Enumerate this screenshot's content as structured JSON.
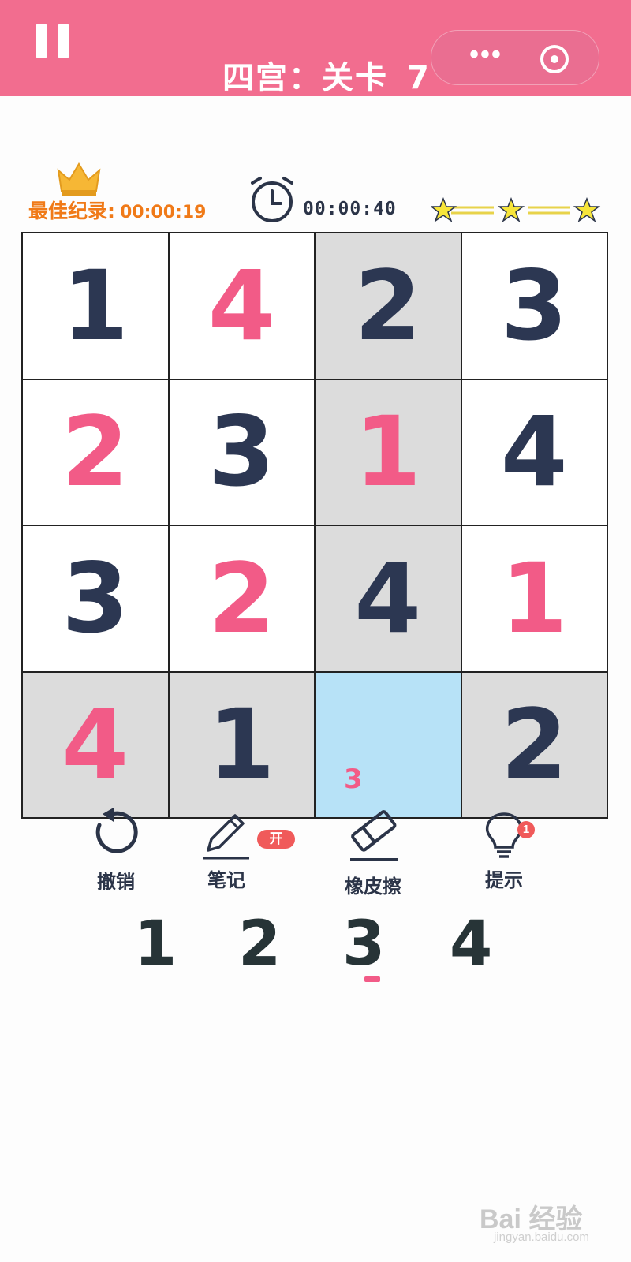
{
  "header": {
    "title": "四宫：关卡",
    "level": "7",
    "menu_dots": "•••",
    "pause_icon": "pause-icon",
    "record_icon": "target-icon"
  },
  "stats": {
    "best_label": "最佳纪录:",
    "best_time": "00:00:19",
    "elapsed_time": "00:00:40",
    "stars": 3
  },
  "board": {
    "rows": [
      [
        {
          "v": "1",
          "t": "given",
          "shade": false
        },
        {
          "v": "4",
          "t": "user",
          "shade": false
        },
        {
          "v": "2",
          "t": "given",
          "shade": true
        },
        {
          "v": "3",
          "t": "given",
          "shade": false
        }
      ],
      [
        {
          "v": "2",
          "t": "user",
          "shade": false
        },
        {
          "v": "3",
          "t": "given",
          "shade": false
        },
        {
          "v": "1",
          "t": "user",
          "shade": true
        },
        {
          "v": "4",
          "t": "given",
          "shade": false
        }
      ],
      [
        {
          "v": "3",
          "t": "given",
          "shade": false
        },
        {
          "v": "2",
          "t": "user",
          "shade": false
        },
        {
          "v": "4",
          "t": "given",
          "shade": true
        },
        {
          "v": "1",
          "t": "user",
          "shade": false
        }
      ],
      [
        {
          "v": "4",
          "t": "user",
          "shade": true
        },
        {
          "v": "1",
          "t": "given",
          "shade": true
        },
        {
          "v": "",
          "note": "3",
          "selected": true
        },
        {
          "v": "2",
          "t": "given",
          "shade": true
        }
      ]
    ]
  },
  "tools": {
    "undo": "撤销",
    "notes": "笔记",
    "notes_badge": "开",
    "eraser": "橡皮擦",
    "hint": "提示",
    "hint_count": "1"
  },
  "numpad": [
    "1",
    "2",
    "3",
    "4"
  ],
  "watermark": {
    "main": "Bai 经验",
    "sub": "jingyan.baidu.com"
  },
  "colors": {
    "header": "#f26d8f",
    "given_digit": "#2c3752",
    "user_digit": "#f25b87",
    "selected_cell": "#b7e2f7",
    "shaded_cell": "#dcdcdc"
  }
}
